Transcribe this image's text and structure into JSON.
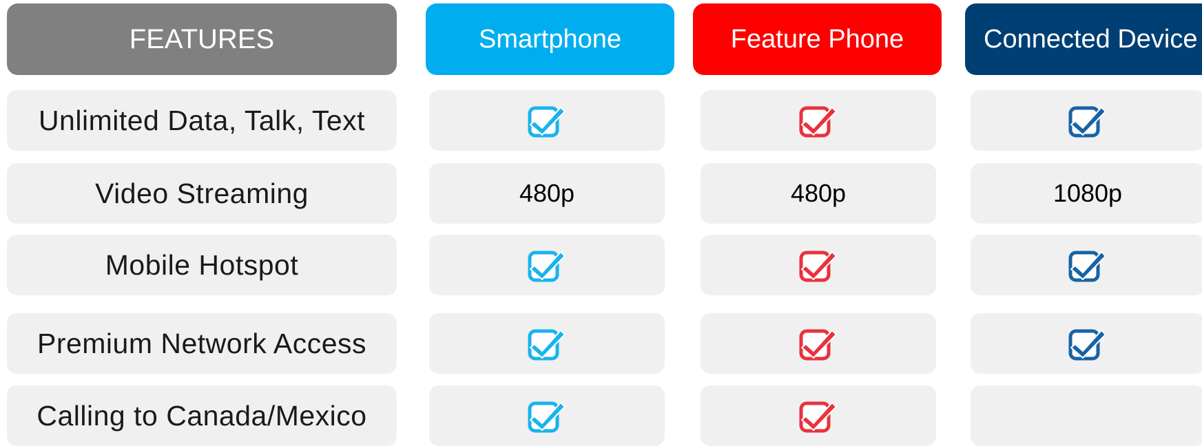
{
  "colors": {
    "features_header": "#808080",
    "smartphone": "#00aeef",
    "feature_phone": "#ff0000",
    "connected_device": "#003f73",
    "smartphone_check": "#1ab3ec",
    "feature_phone_check": "#e8323c",
    "connected_device_check": "#1763a6",
    "cell_background": "#f0f0f0"
  },
  "header": {
    "features": "FEATURES",
    "smartphone": "Smartphone",
    "feature_phone": "Feature Phone",
    "connected_device": "Connected Device"
  },
  "rows": [
    {
      "feature": "Unlimited Data, Talk, Text",
      "smartphone": "check-icon",
      "feature_phone": "check-icon",
      "connected_device": "check-icon"
    },
    {
      "feature": "Video Streaming",
      "smartphone": "480p",
      "feature_phone": "480p",
      "connected_device": "1080p"
    },
    {
      "feature": "Mobile Hotspot",
      "smartphone": "check-icon",
      "feature_phone": "check-icon",
      "connected_device": "check-icon"
    },
    {
      "feature": "Premium Network Access",
      "smartphone": "check-icon",
      "feature_phone": "check-icon",
      "connected_device": "check-icon"
    },
    {
      "feature": "Calling to Canada/Mexico",
      "smartphone": "check-icon",
      "feature_phone": "check-icon",
      "connected_device": ""
    }
  ]
}
